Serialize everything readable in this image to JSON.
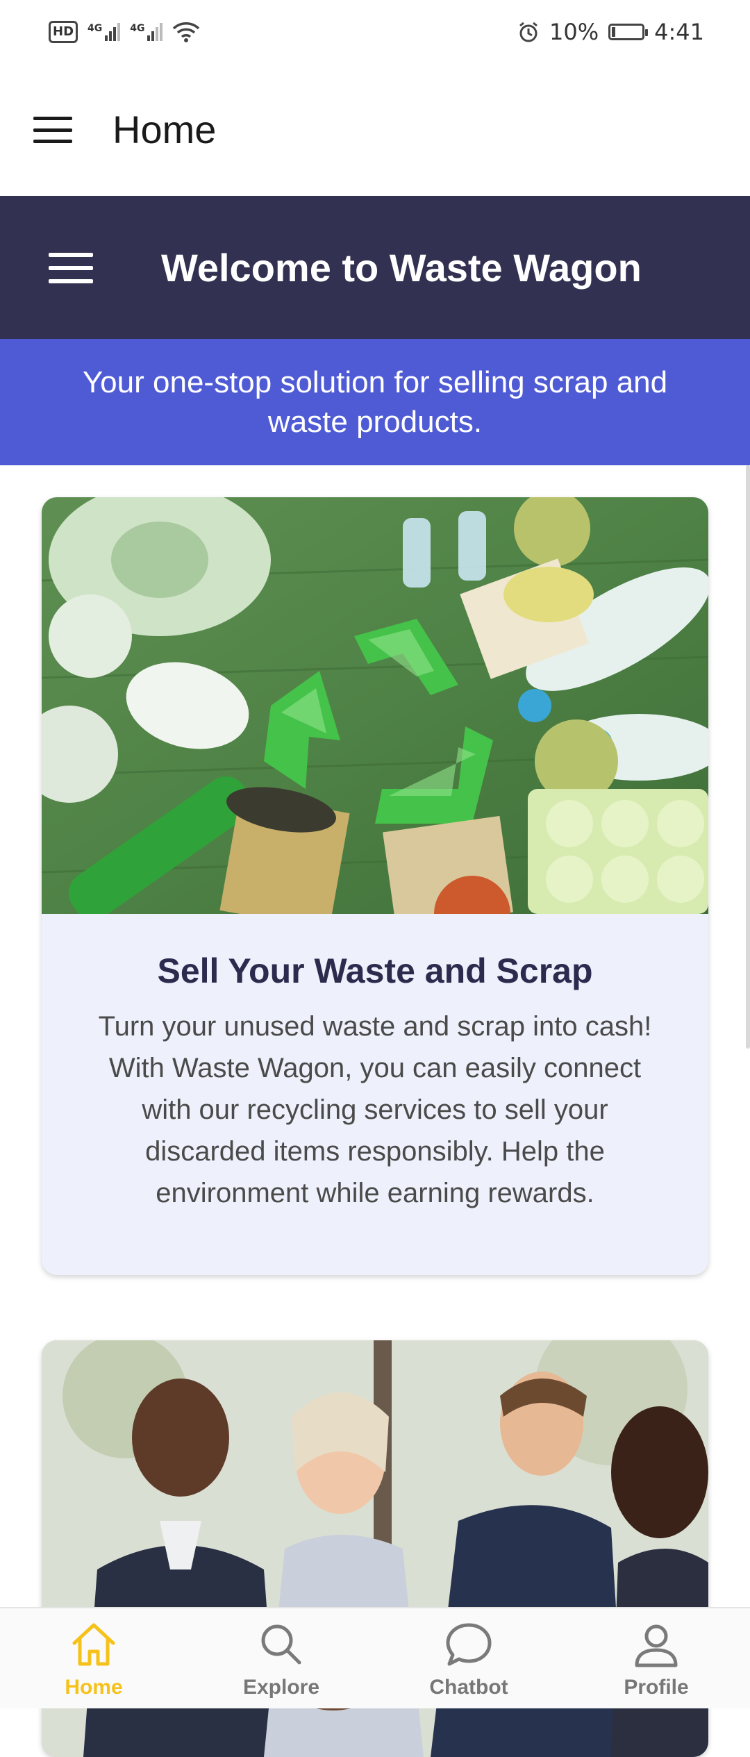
{
  "status_bar": {
    "hd": "HD",
    "network_1": "4G",
    "network_2": "4G",
    "battery": "10%",
    "time": "4:41"
  },
  "app_bar": {
    "title": "Home"
  },
  "welcome": {
    "title": "Welcome to Waste Wagon"
  },
  "tagline": "Your one-stop solution for selling scrap and waste products.",
  "cards": [
    {
      "title": "Sell Your Waste and Scrap",
      "text": "Turn your unused waste and scrap into cash! With Waste Wagon, you can easily connect with our recycling services to sell your discarded items responsibly. Help the environment while earning rewards."
    }
  ],
  "bottom_nav": [
    {
      "label": "Home",
      "icon": "home-icon",
      "active": true
    },
    {
      "label": "Explore",
      "icon": "search-icon",
      "active": false
    },
    {
      "label": "Chatbot",
      "icon": "chat-bubble-icon",
      "active": false
    },
    {
      "label": "Profile",
      "icon": "person-icon",
      "active": false
    }
  ],
  "colors": {
    "header_bg": "#323151",
    "tagline_bg": "#4f5bd5",
    "card_bg": "#eef0fb",
    "active_nav": "#f5c21b",
    "card_title": "#2c2b4e"
  }
}
